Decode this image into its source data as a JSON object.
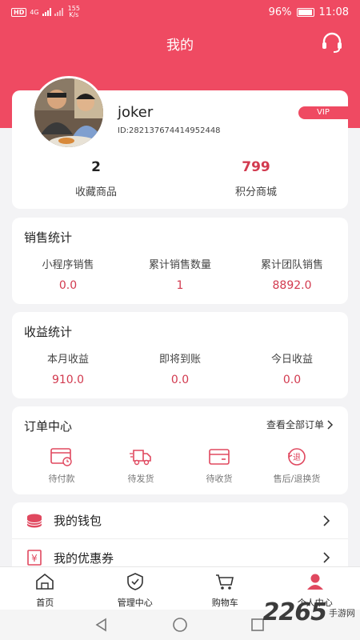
{
  "status": {
    "network": "HD",
    "signal": "4G",
    "speed": "155",
    "speed_unit": "K/s",
    "battery": "96%",
    "time": "11:08"
  },
  "header": {
    "title": "我的"
  },
  "profile": {
    "username": "joker",
    "id": "ID:282137674414952448",
    "badge": "VIP",
    "stats": [
      {
        "value": "2",
        "label": "收藏商品"
      },
      {
        "value": "799",
        "label": "积分商城"
      }
    ]
  },
  "sales": {
    "title": "销售统计",
    "items": [
      {
        "label": "小程序销售",
        "value": "0.0"
      },
      {
        "label": "累计销售数量",
        "value": "1"
      },
      {
        "label": "累计团队销售",
        "value": "8892.0"
      }
    ]
  },
  "income": {
    "title": "收益统计",
    "items": [
      {
        "label": "本月收益",
        "value": "910.0"
      },
      {
        "label": "即将到账",
        "value": "0.0"
      },
      {
        "label": "今日收益",
        "value": "0.0"
      }
    ]
  },
  "orders": {
    "title": "订单中心",
    "view_all": "查看全部订单",
    "items": [
      {
        "label": "待付款",
        "icon": "wallet-card-icon"
      },
      {
        "label": "待发货",
        "icon": "delivery-truck-icon"
      },
      {
        "label": "待收货",
        "icon": "receive-box-icon"
      },
      {
        "label": "售后/退换货",
        "icon": "refund-icon"
      },
      {
        "label": "退"
      }
    ]
  },
  "menu": [
    {
      "label": "我的钱包",
      "icon": "coins-icon"
    },
    {
      "label": "我的优惠券",
      "icon": "coupon-yen-icon"
    }
  ],
  "nav": [
    {
      "label": "首页",
      "icon": "home-icon"
    },
    {
      "label": "管理中心",
      "icon": "shield-check-icon"
    },
    {
      "label": "购物车",
      "icon": "cart-icon"
    },
    {
      "label": "个人中心",
      "icon": "person-icon"
    }
  ],
  "watermark": {
    "number": "2265",
    "site": "手游网"
  },
  "colors": {
    "brand": "#ef4a62",
    "value_red": "#d23a4f"
  }
}
